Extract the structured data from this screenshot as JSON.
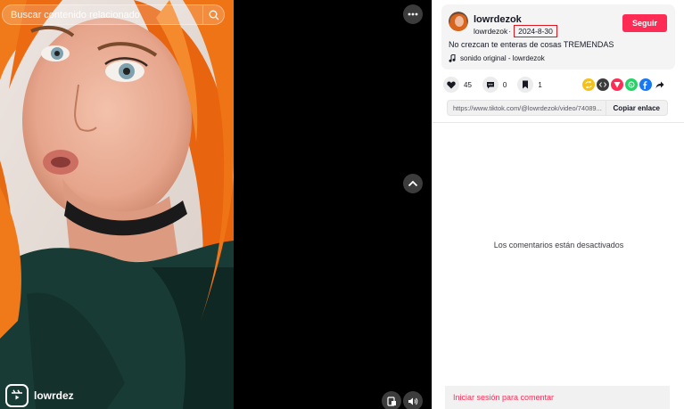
{
  "video": {
    "search_placeholder": "Buscar contenido relacionado",
    "brand_name": "lowrdez"
  },
  "post": {
    "author_name": "lowrdezok",
    "author_handle": "lowrdezok",
    "date": "2024-8-30",
    "follow_label": "Seguir",
    "caption": "No crezcan te enteras de cosas TREMENDAS",
    "music": "sonido original - lowrdezok"
  },
  "actions": {
    "likes": "45",
    "comments": "0",
    "saves": "1"
  },
  "share_icons": [
    "repost-icon",
    "embed-icon",
    "send-icon",
    "whatsapp-icon",
    "facebook-icon",
    "share-arrow-icon"
  ],
  "link": {
    "url": "https://www.tiktok.com/@lowrdezok/video/74089...",
    "copy_label": "Copiar enlace"
  },
  "comments": {
    "disabled_text": "Los comentarios están desactivados",
    "login_prompt": "Iniciar sesión para comentar"
  },
  "colors": {
    "brand_accent": "#fe2c55",
    "highlight_box": "#e0151d"
  }
}
